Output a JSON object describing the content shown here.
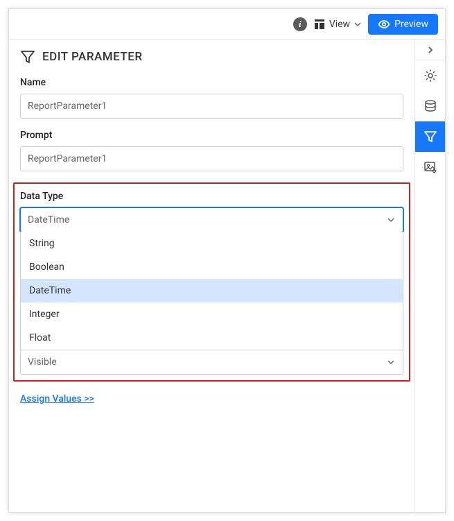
{
  "toolbar": {
    "view_label": "View",
    "preview_label": "Preview"
  },
  "panel": {
    "title": "EDIT PARAMETER",
    "name_label": "Name",
    "name_value": "ReportParameter1",
    "prompt_label": "Prompt",
    "prompt_value": "ReportParameter1",
    "datatype_label": "Data Type",
    "datatype_value": "DateTime",
    "datatype_options": [
      "String",
      "Boolean",
      "DateTime",
      "Integer",
      "Float"
    ],
    "datatype_selected_index": 2,
    "visibility_value": "Visible",
    "assign_values_label": "Assign Values >>"
  }
}
